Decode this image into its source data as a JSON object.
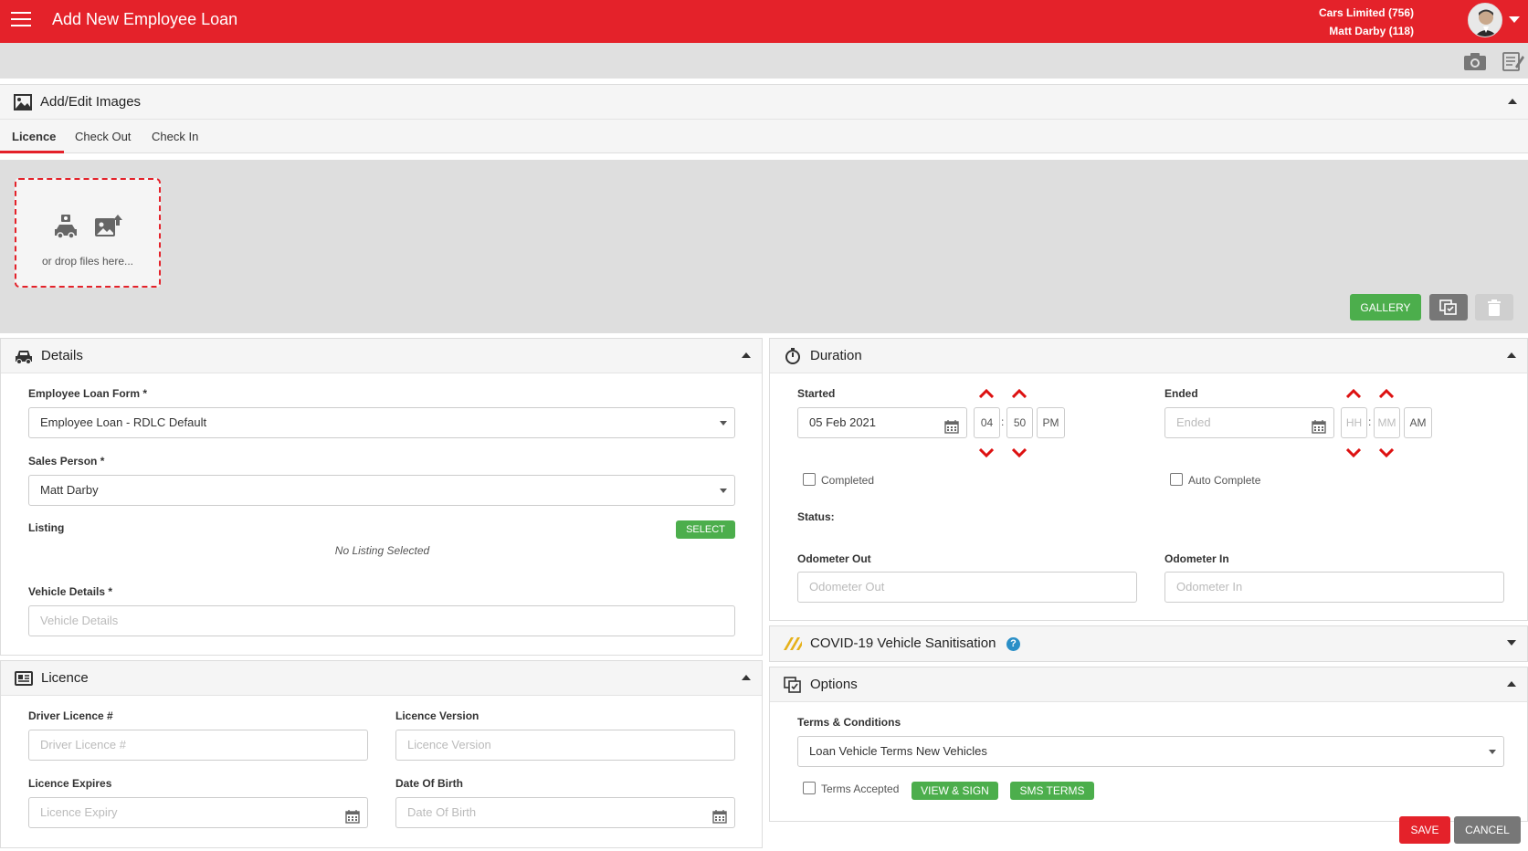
{
  "header": {
    "title": "Add New Employee Loan",
    "company": "Cars Limited (756)",
    "user": "Matt Darby (118)"
  },
  "images": {
    "title": "Add/Edit Images",
    "tabs": [
      "Licence",
      "Check Out",
      "Check In"
    ],
    "dropzone_text": "or drop files here...",
    "gallery_label": "GALLERY"
  },
  "details": {
    "title": "Details",
    "loan_form_label": "Employee Loan Form *",
    "loan_form_value": "Employee Loan - RDLC Default",
    "sales_person_label": "Sales Person *",
    "sales_person_value": "Matt Darby",
    "listing_label": "Listing",
    "select_label": "SELECT",
    "no_listing": "No Listing Selected",
    "vehicle_label": "Vehicle Details *",
    "vehicle_placeholder": "Vehicle Details"
  },
  "licence": {
    "title": "Licence",
    "driver_label": "Driver Licence #",
    "driver_placeholder": "Driver Licence #",
    "version_label": "Licence Version",
    "version_placeholder": "Licence Version",
    "expires_label": "Licence Expires",
    "expires_placeholder": "Licence Expiry",
    "dob_label": "Date Of Birth",
    "dob_placeholder": "Date Of Birth"
  },
  "duration": {
    "title": "Duration",
    "started_label": "Started",
    "started_date": "05 Feb 2021",
    "started_hour": "04",
    "started_min": "50",
    "started_ampm": "PM",
    "ended_label": "Ended",
    "ended_placeholder": "Ended",
    "ended_hour_ph": "HH",
    "ended_min_ph": "MM",
    "ended_ampm": "AM",
    "time_sep": ":",
    "completed_label": "Completed",
    "auto_complete_label": "Auto Complete",
    "status_label": "Status:",
    "odo_out_label": "Odometer Out",
    "odo_out_placeholder": "Odometer Out",
    "odo_in_label": "Odometer In",
    "odo_in_placeholder": "Odometer In"
  },
  "covid": {
    "title": "COVID-19 Vehicle Sanitisation",
    "help": "?"
  },
  "options": {
    "title": "Options",
    "terms_label": "Terms & Conditions",
    "terms_value": "Loan Vehicle Terms New Vehicles",
    "terms_accepted_label": "Terms Accepted",
    "view_sign_label": "VIEW & SIGN",
    "sms_terms_label": "SMS TERMS"
  },
  "footer": {
    "save_label": "SAVE",
    "cancel_label": "CANCEL"
  },
  "colors": {
    "brand_red": "#e4222a",
    "green": "#4cae4c",
    "grey_btn": "#777777"
  }
}
